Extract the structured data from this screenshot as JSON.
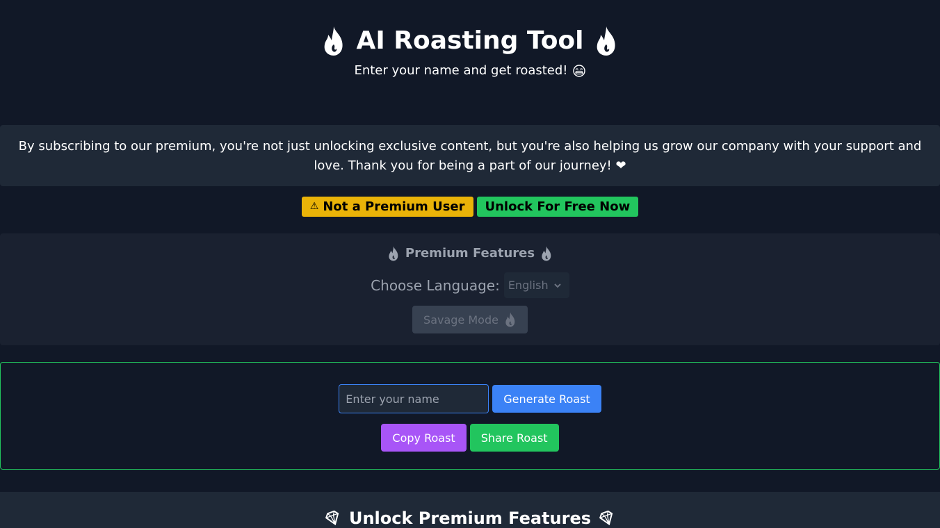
{
  "header": {
    "title": "AI Roasting Tool",
    "title_icon": "fire-icon",
    "subtitle": "Enter your name and get roasted!",
    "subtitle_icon": "laughing-emoji-icon"
  },
  "notice": {
    "text": "By subscribing to our premium, you're not just unlocking exclusive content, but you're also helping us grow our company with your support and love. Thank you for being a part of our journey! ❤"
  },
  "status": {
    "warning_icon": "⚠",
    "warning_label": "Not a Premium User",
    "unlock_label": "Unlock For Free Now",
    "colors": {
      "warning": "#eab308",
      "unlock": "#22c55e"
    }
  },
  "premium": {
    "title": "Premium Features",
    "language_label": "Choose Language:",
    "language_selected": "English",
    "savage_label": "Savage Mode"
  },
  "roast": {
    "name_placeholder": "Enter your name",
    "name_value": "",
    "generate_label": "Generate Roast",
    "copy_label": "Copy Roast",
    "share_label": "Share Roast",
    "colors": {
      "generate": "#3b82f6",
      "copy": "#a855f7",
      "share": "#22c55e",
      "border": "#22c55e"
    }
  },
  "unlock_section": {
    "title": "Unlock Premium Features",
    "icon": "gem-icon"
  }
}
